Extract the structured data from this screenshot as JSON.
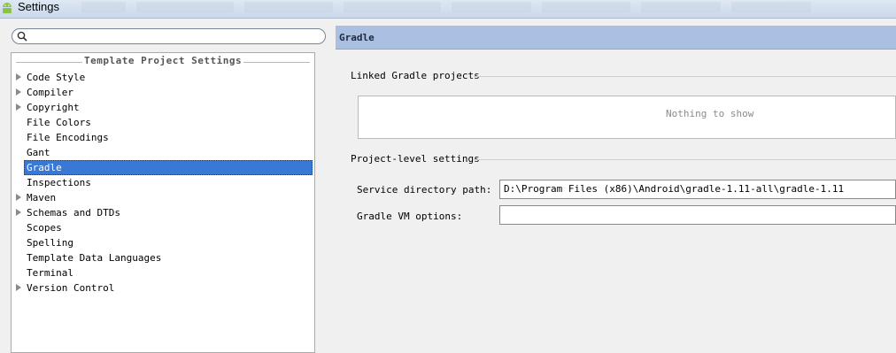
{
  "window": {
    "title": "Settings",
    "icon": "android-icon"
  },
  "search": {
    "value": "",
    "placeholder": ""
  },
  "tree": {
    "header": "Template Project Settings",
    "items": [
      {
        "label": "Code Style",
        "expandable": true
      },
      {
        "label": "Compiler",
        "expandable": true
      },
      {
        "label": "Copyright",
        "expandable": true
      },
      {
        "label": "File Colors",
        "expandable": false
      },
      {
        "label": "File Encodings",
        "expandable": false
      },
      {
        "label": "Gant",
        "expandable": false
      },
      {
        "label": "Gradle",
        "expandable": false,
        "selected": true
      },
      {
        "label": "Inspections",
        "expandable": false
      },
      {
        "label": "Maven",
        "expandable": true
      },
      {
        "label": "Schemas and DTDs",
        "expandable": true
      },
      {
        "label": "Scopes",
        "expandable": false
      },
      {
        "label": "Spelling",
        "expandable": false
      },
      {
        "label": "Template Data Languages",
        "expandable": false
      },
      {
        "label": "Terminal",
        "expandable": false
      },
      {
        "label": "Version Control",
        "expandable": true
      }
    ]
  },
  "panel": {
    "title": "Gradle",
    "linked_projects": {
      "title": "Linked Gradle projects",
      "empty_text": "Nothing to show"
    },
    "project_level": {
      "title": "Project-level settings",
      "service_dir": {
        "label": "Service directory path:",
        "value": "D:\\Program Files (x86)\\Android\\gradle-1.11-all\\gradle-1.11"
      },
      "vm_options": {
        "label": "Gradle VM options:",
        "value": ""
      }
    }
  },
  "colors": {
    "selection": "#3a78d6",
    "header_bg": "#a9c0e2"
  }
}
